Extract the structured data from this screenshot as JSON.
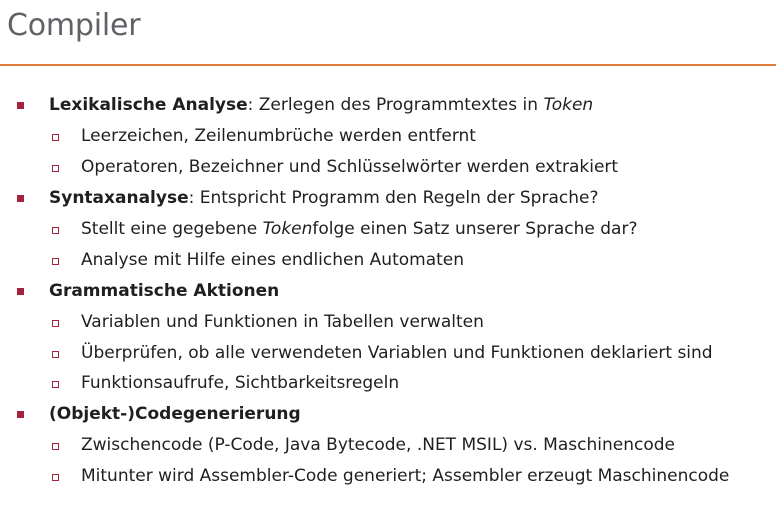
{
  "title": "Compiler",
  "colors": {
    "title_rule": "#e07b39",
    "bullet": "#a3223e",
    "title_text": "#5f6266"
  },
  "items": [
    {
      "bold": "Lexikalische Analyse",
      "rest": ": Zerlegen des Programmtextes in ",
      "italic": "Token",
      "sub": [
        {
          "text": "Leerzeichen, Zeilenumbrüche werden entfernt"
        },
        {
          "text": "Operatoren, Bezeichner und Schlüsselwörter werden extrakiert"
        }
      ]
    },
    {
      "bold": "Syntaxanalyse",
      "rest": ": Entspricht Programm den Regeln der Sprache?",
      "sub": [
        {
          "pre": "Stellt eine gegebene ",
          "italic": "Token",
          "post": "folge einen Satz unserer Sprache dar?"
        },
        {
          "text": "Analyse mit Hilfe eines endlichen Automaten"
        }
      ]
    },
    {
      "bold": "Grammatische Aktionen",
      "sub": [
        {
          "text": "Variablen und Funktionen in Tabellen verwalten"
        },
        {
          "text": "Überprüfen, ob alle verwendeten Variablen und Funktionen deklariert sind"
        },
        {
          "text": "Funktionsaufrufe, Sichtbarkeitsregeln"
        }
      ]
    },
    {
      "bold": "(Objekt-)Codegenerierung",
      "sub": [
        {
          "text": "Zwischencode (P-Code, Java Bytecode, .NET MSIL) vs. Maschinencode"
        },
        {
          "text": "Mitunter wird Assembler-Code generiert; Assembler erzeugt Maschinencode"
        }
      ]
    }
  ]
}
